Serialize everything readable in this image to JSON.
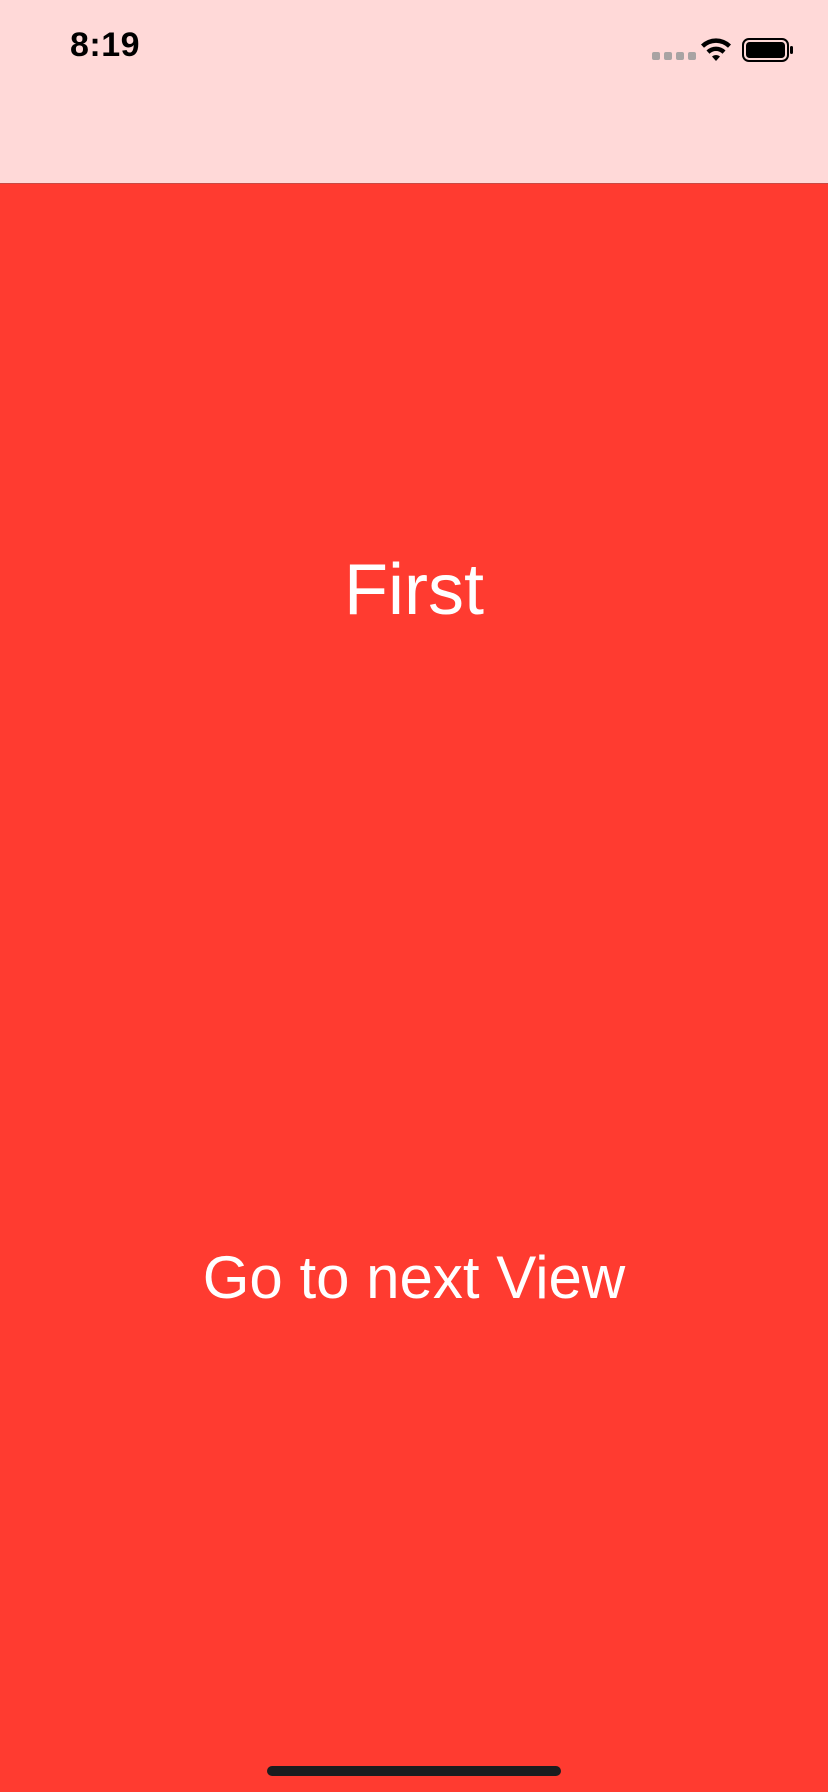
{
  "status_bar": {
    "time": "8:19",
    "signal_icon": "cellular-signal-icon",
    "wifi_icon": "wifi-icon",
    "battery_icon": "battery-icon"
  },
  "colors": {
    "background": "#FF3B30",
    "nav_background": "#FFD9D8",
    "text": "#FFFFFF"
  },
  "main": {
    "title": "First",
    "next_button_label": "Go to next View"
  }
}
